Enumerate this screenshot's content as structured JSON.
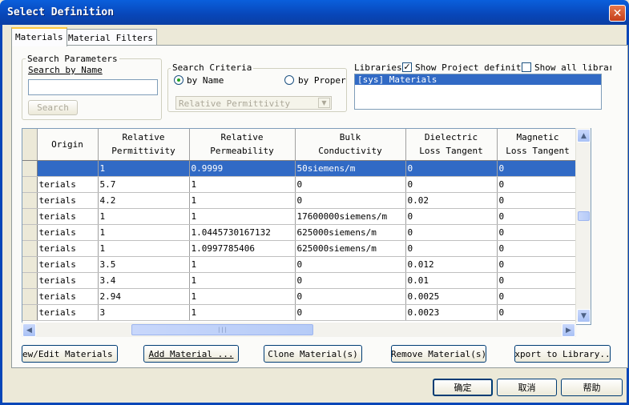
{
  "window": {
    "title": "Select Definition",
    "close_glyph": "✕"
  },
  "tabs": [
    {
      "label": "Materials",
      "active": true
    },
    {
      "label": "Material Filters",
      "active": false
    }
  ],
  "search_parameters": {
    "legend": "Search Parameters",
    "search_by_name_label": "Search by Name",
    "search_by_name_value": "",
    "search_button": "Search"
  },
  "search_criteria": {
    "legend": "Search Criteria",
    "by_name": "by Name",
    "by_property": "by Propert",
    "selected": "by Name",
    "property_value": "Relative Permittivity"
  },
  "libraries": {
    "label": "Libraries",
    "show_project_label": "Show Project definitic",
    "show_project_checked": true,
    "show_all_label": "Show all librari",
    "show_all_checked": false,
    "items": [
      "[sys] Materials"
    ],
    "selected_index": 0
  },
  "table": {
    "columns": [
      {
        "line1": "Origin",
        "line2": ""
      },
      {
        "line1": "Relative",
        "line2": "Permittivity"
      },
      {
        "line1": "Relative",
        "line2": "Permeability"
      },
      {
        "line1": "Bulk",
        "line2": "Conductivity"
      },
      {
        "line1": "Dielectric",
        "line2": "Loss Tangent"
      },
      {
        "line1": "Magnetic",
        "line2": "Loss Tangent"
      }
    ],
    "rows": [
      [
        "",
        "1",
        "0.9999",
        "50siemens/m",
        "0",
        "0"
      ],
      [
        "terials",
        "5.7",
        "1",
        "0",
        "0",
        "0"
      ],
      [
        "terials",
        "4.2",
        "1",
        "0",
        "0.02",
        "0"
      ],
      [
        "terials",
        "1",
        "1",
        "17600000siemens/m",
        "0",
        "0"
      ],
      [
        "terials",
        "1",
        "1.0445730167132",
        "625000siemens/m",
        "0",
        "0"
      ],
      [
        "terials",
        "1",
        "1.0997785406",
        "625000siemens/m",
        "0",
        "0"
      ],
      [
        "terials",
        "3.5",
        "1",
        "0",
        "0.012",
        "0"
      ],
      [
        "terials",
        "3.4",
        "1",
        "0",
        "0.01",
        "0"
      ],
      [
        "terials",
        "2.94",
        "1",
        "0",
        "0.0025",
        "0"
      ],
      [
        "terials",
        "3",
        "1",
        "0",
        "0.0023",
        "0"
      ]
    ],
    "selected_row": 0
  },
  "action_buttons": {
    "view_edit": "ew/Edit Materials .",
    "add": "Add Material ...",
    "clone": "Clone Material(s)",
    "remove": "Remove Material(s)",
    "export": "Export to Library..."
  },
  "dialog_buttons": {
    "ok": "确定",
    "cancel": "取消",
    "help": "帮助"
  }
}
